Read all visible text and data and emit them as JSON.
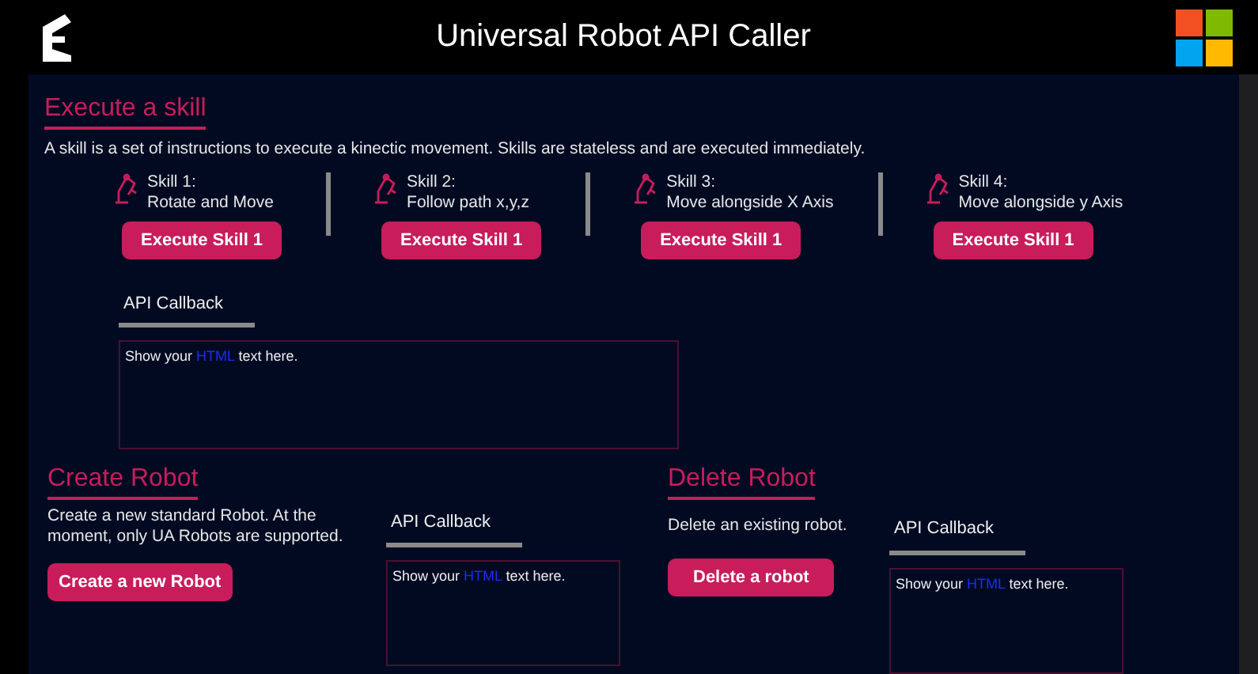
{
  "header": {
    "title": "Universal Robot API Caller"
  },
  "execute_skill": {
    "title": "Execute a skill",
    "description": "A skill is a set of instructions to execute a kinectic movement. Skills are stateless and are executed immediately.",
    "skills": [
      {
        "name": "Skill 1:",
        "label": "Rotate and Move",
        "button": "Execute Skill 1"
      },
      {
        "name": "Skill 2:",
        "label": "Follow path x,y,z",
        "button": "Execute Skill 1"
      },
      {
        "name": "Skill 3:",
        "label": "Move alongside X Axis",
        "button": "Execute Skill 1"
      },
      {
        "name": "Skill 4:",
        "label": "Move alongside y Axis",
        "button": "Execute Skill 1"
      }
    ],
    "callback": {
      "label": "API Callback",
      "before": "Show your ",
      "highlight": "HTML",
      "after": " text here."
    }
  },
  "create_robot": {
    "title": "Create Robot",
    "description": "Create a new standard Robot. At the moment, only UA Robots are supported.",
    "button": "Create a new Robot",
    "callback": {
      "label": "API Callback",
      "before": "Show your ",
      "highlight": "HTML",
      "after": " text here."
    }
  },
  "delete_robot": {
    "title": "Delete Robot",
    "description": "Delete an existing robot.",
    "button": "Delete a robot",
    "callback": {
      "label": "API Callback",
      "before": "Show your ",
      "highlight": "HTML",
      "after": " text here."
    }
  }
}
